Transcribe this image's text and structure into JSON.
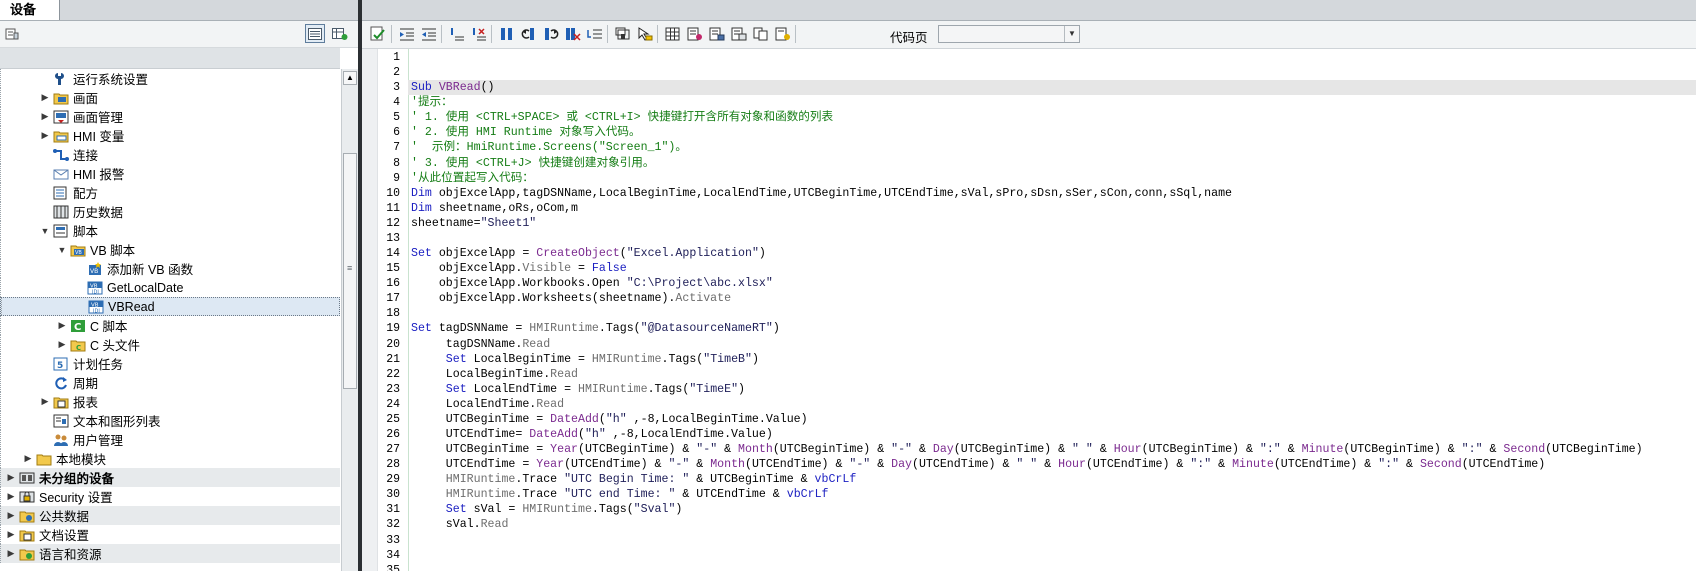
{
  "left_panel": {
    "tab_label": "设备",
    "tree": [
      {
        "label": "运行系统设置",
        "icon": "wrench-icon",
        "level": 3,
        "expander": "none"
      },
      {
        "label": "画面",
        "icon": "folder-screen-icon",
        "level": 3,
        "expander": "collapsed"
      },
      {
        "label": "画面管理",
        "icon": "screen-management-icon",
        "level": 3,
        "expander": "collapsed"
      },
      {
        "label": "HMI 变量",
        "icon": "hmi-tags-icon",
        "level": 3,
        "expander": "collapsed"
      },
      {
        "label": "连接",
        "icon": "connection-icon",
        "level": 3,
        "expander": "none"
      },
      {
        "label": "HMI 报警",
        "icon": "alarm-envelope-icon",
        "level": 3,
        "expander": "none"
      },
      {
        "label": "配方",
        "icon": "recipe-icon",
        "level": 3,
        "expander": "none"
      },
      {
        "label": "历史数据",
        "icon": "history-data-icon",
        "level": 3,
        "expander": "none"
      },
      {
        "label": "脚本",
        "icon": "script-icon",
        "level": 3,
        "expander": "expanded"
      },
      {
        "label": "VB 脚本",
        "icon": "vb-folder-icon",
        "level": 4,
        "expander": "expanded"
      },
      {
        "label": "添加新 VB 函数",
        "icon": "add-vb-function-icon",
        "level": 5,
        "expander": "none"
      },
      {
        "label": "GetLocalDate",
        "icon": "vb-script-icon",
        "level": 5,
        "expander": "none"
      },
      {
        "label": "VBRead",
        "icon": "vb-script-icon",
        "level": 5,
        "expander": "none",
        "selected": true
      },
      {
        "label": "C 脚本",
        "icon": "c-script-icon",
        "level": 4,
        "expander": "collapsed"
      },
      {
        "label": "C 头文件",
        "icon": "c-header-icon",
        "level": 4,
        "expander": "collapsed"
      },
      {
        "label": "计划任务",
        "icon": "scheduled-task-icon",
        "level": 3,
        "expander": "none"
      },
      {
        "label": "周期",
        "icon": "cycle-icon",
        "level": 3,
        "expander": "none"
      },
      {
        "label": "报表",
        "icon": "report-icon",
        "level": 3,
        "expander": "collapsed"
      },
      {
        "label": "文本和图形列表",
        "icon": "text-graphic-list-icon",
        "level": 3,
        "expander": "none"
      },
      {
        "label": "用户管理",
        "icon": "user-management-icon",
        "level": 3,
        "expander": "none"
      },
      {
        "label": "本地模块",
        "icon": "local-module-icon",
        "level": 2,
        "expander": "collapsed"
      },
      {
        "label": "未分组的设备",
        "icon": "ungrouped-devices-icon",
        "level": 1,
        "expander": "collapsed",
        "bold": true,
        "dark": true
      },
      {
        "label": "Security 设置",
        "icon": "security-settings-icon",
        "level": 1,
        "expander": "collapsed"
      },
      {
        "label": "公共数据",
        "icon": "common-data-icon",
        "level": 1,
        "expander": "collapsed",
        "dark": true
      },
      {
        "label": "文档设置",
        "icon": "document-settings-icon",
        "level": 1,
        "expander": "collapsed"
      },
      {
        "label": "语言和资源",
        "icon": "languages-resources-icon",
        "level": 1,
        "expander": "collapsed",
        "dark": true
      }
    ]
  },
  "editor": {
    "codepage_label": "代码页",
    "codepage_value": "",
    "line_numbers": [
      "1",
      "2",
      "3",
      "4",
      "5",
      "6",
      "7",
      "8",
      "9",
      "10",
      "11",
      "12",
      "13",
      "14",
      "15",
      "16",
      "17",
      "18",
      "19",
      "20",
      "21",
      "22",
      "23",
      "24",
      "25",
      "26",
      "27",
      "28",
      "29",
      "30",
      "31",
      "32",
      "33",
      "34",
      "35"
    ],
    "code_lines": [
      [],
      [],
      [
        [
          "kw",
          "Sub "
        ],
        [
          "fn",
          "VBRead"
        ],
        [
          "",
          "()"
        ]
      ],
      [
        [
          "cm",
          "'提示："
        ]
      ],
      [
        [
          "cm",
          "' 1. 使用 <CTRL+SPACE> 或 <CTRL+I> 快捷键打开含所有对象和函数的列表"
        ]
      ],
      [
        [
          "cm",
          "' 2. 使用 HMI Runtime 对象写入代码。"
        ]
      ],
      [
        [
          "cm",
          "'  示例：HmiRuntime.Screens(\"Screen_1\")。"
        ]
      ],
      [
        [
          "cm",
          "' 3. 使用 <CTRL+J> 快捷键创建对象引用。"
        ]
      ],
      [
        [
          "cm",
          "'从此位置起写入代码："
        ]
      ],
      [
        [
          "kw",
          "Dim "
        ],
        [
          "",
          "objExcelApp,tagDSNName,LocalBeginTime,LocalEndTime,UTCBeginTime,UTCEndTime,sVal,sPro,sDsn,sSer,sCon,conn,sSql,name"
        ]
      ],
      [
        [
          "kw",
          "Dim "
        ],
        [
          "",
          "sheetname,oRs,oCom,m"
        ]
      ],
      [
        [
          "",
          "sheetname="
        ],
        [
          "str",
          "\"Sheet1\""
        ]
      ],
      [],
      [
        [
          "kw",
          "Set "
        ],
        [
          "",
          "objExcelApp = "
        ],
        [
          "fn",
          "CreateObject"
        ],
        [
          "",
          "("
        ],
        [
          "str",
          "\"Excel.Application\""
        ],
        [
          "",
          ")"
        ]
      ],
      [
        [
          "",
          "    objExcelApp."
        ],
        [
          "prop",
          "Visible"
        ],
        [
          "",
          " = "
        ],
        [
          "kw",
          "False"
        ]
      ],
      [
        [
          "",
          "    objExcelApp.Workbooks.Open "
        ],
        [
          "str",
          "\"C:\\Project\\abc.xlsx\""
        ]
      ],
      [
        [
          "",
          "    objExcelApp.Worksheets(sheetname)."
        ],
        [
          "prop",
          "Activate"
        ]
      ],
      [],
      [
        [
          "kw",
          "Set "
        ],
        [
          "",
          "tagDSNName = "
        ],
        [
          "prop",
          "HMIRuntime"
        ],
        [
          "",
          ".Tags("
        ],
        [
          "str",
          "\"@DatasourceNameRT\""
        ],
        [
          "",
          ")"
        ]
      ],
      [
        [
          "",
          "     tagDSNName."
        ],
        [
          "prop",
          "Read"
        ]
      ],
      [
        [
          "kw",
          "     Set "
        ],
        [
          "",
          "LocalBeginTime = "
        ],
        [
          "prop",
          "HMIRuntime"
        ],
        [
          "",
          ".Tags("
        ],
        [
          "str",
          "\"TimeB\""
        ],
        [
          "",
          ")"
        ]
      ],
      [
        [
          "",
          "     LocalBeginTime."
        ],
        [
          "prop",
          "Read"
        ]
      ],
      [
        [
          "kw",
          "     Set "
        ],
        [
          "",
          "LocalEndTime = "
        ],
        [
          "prop",
          "HMIRuntime"
        ],
        [
          "",
          ".Tags("
        ],
        [
          "str",
          "\"TimeE\""
        ],
        [
          "",
          ")"
        ]
      ],
      [
        [
          "",
          "     LocalEndTime."
        ],
        [
          "prop",
          "Read"
        ]
      ],
      [
        [
          "",
          "     UTCBeginTime = "
        ],
        [
          "fn",
          "DateAdd"
        ],
        [
          "",
          "("
        ],
        [
          "str",
          "\"h\""
        ],
        [
          "",
          " ,-8,LocalBeginTime.Value)"
        ]
      ],
      [
        [
          "",
          "     UTCEndTime= "
        ],
        [
          "fn",
          "DateAdd"
        ],
        [
          "",
          "("
        ],
        [
          "str",
          "\"h\""
        ],
        [
          "",
          " ,-8,LocalEndTime.Value)"
        ]
      ],
      [
        [
          "",
          "     UTCBeginTime = "
        ],
        [
          "fn",
          "Year"
        ],
        [
          "",
          "(UTCBeginTime) & "
        ],
        [
          "str",
          "\"-\""
        ],
        [
          "",
          " & "
        ],
        [
          "fn",
          "Month"
        ],
        [
          "",
          "(UTCBeginTime) & "
        ],
        [
          "str",
          "\"-\""
        ],
        [
          "",
          " & "
        ],
        [
          "fn",
          "Day"
        ],
        [
          "",
          "(UTCBeginTime) & "
        ],
        [
          "str",
          "\" \""
        ],
        [
          "",
          " & "
        ],
        [
          "fn",
          "Hour"
        ],
        [
          "",
          "(UTCBeginTime) & "
        ],
        [
          "str",
          "\":\""
        ],
        [
          "",
          " & "
        ],
        [
          "fn",
          "Minute"
        ],
        [
          "",
          "(UTCBeginTime) & "
        ],
        [
          "str",
          "\":\""
        ],
        [
          "",
          " & "
        ],
        [
          "fn",
          "Second"
        ],
        [
          "",
          "(UTCBeginTime)"
        ]
      ],
      [
        [
          "",
          "     UTCEndTime = "
        ],
        [
          "fn",
          "Year"
        ],
        [
          "",
          "(UTCEndTime) & "
        ],
        [
          "str",
          "\"-\""
        ],
        [
          "",
          " & "
        ],
        [
          "fn",
          "Month"
        ],
        [
          "",
          "(UTCEndTime) & "
        ],
        [
          "str",
          "\"-\""
        ],
        [
          "",
          " & "
        ],
        [
          "fn",
          "Day"
        ],
        [
          "",
          "(UTCEndTime) & "
        ],
        [
          "str",
          "\" \""
        ],
        [
          "",
          " & "
        ],
        [
          "fn",
          "Hour"
        ],
        [
          "",
          "(UTCEndTime) & "
        ],
        [
          "str",
          "\":\""
        ],
        [
          "",
          " & "
        ],
        [
          "fn",
          "Minute"
        ],
        [
          "",
          "(UTCEndTime) & "
        ],
        [
          "str",
          "\":\""
        ],
        [
          "",
          " & "
        ],
        [
          "fn",
          "Second"
        ],
        [
          "",
          "(UTCEndTime)"
        ]
      ],
      [
        [
          "prop",
          "     HMIRuntime"
        ],
        [
          "",
          ".Trace "
        ],
        [
          "str",
          "\"UTC Begin Time: \""
        ],
        [
          "",
          " & UTCBeginTime & "
        ],
        [
          "kw",
          "vbCrLf"
        ]
      ],
      [
        [
          "prop",
          "     HMIRuntime"
        ],
        [
          "",
          ".Trace "
        ],
        [
          "str",
          "\"UTC end Time: \""
        ],
        [
          "",
          " & UTCEndTime & "
        ],
        [
          "kw",
          "vbCrLf"
        ]
      ],
      [
        [
          "kw",
          "     Set "
        ],
        [
          "",
          "sVal = "
        ],
        [
          "prop",
          "HMIRuntime"
        ],
        [
          "",
          ".Tags("
        ],
        [
          "str",
          "\"Sval\""
        ],
        [
          "",
          ")"
        ]
      ],
      [
        [
          "",
          "     sVal."
        ],
        [
          "prop",
          "Read"
        ]
      ],
      [],
      [],
      []
    ]
  }
}
